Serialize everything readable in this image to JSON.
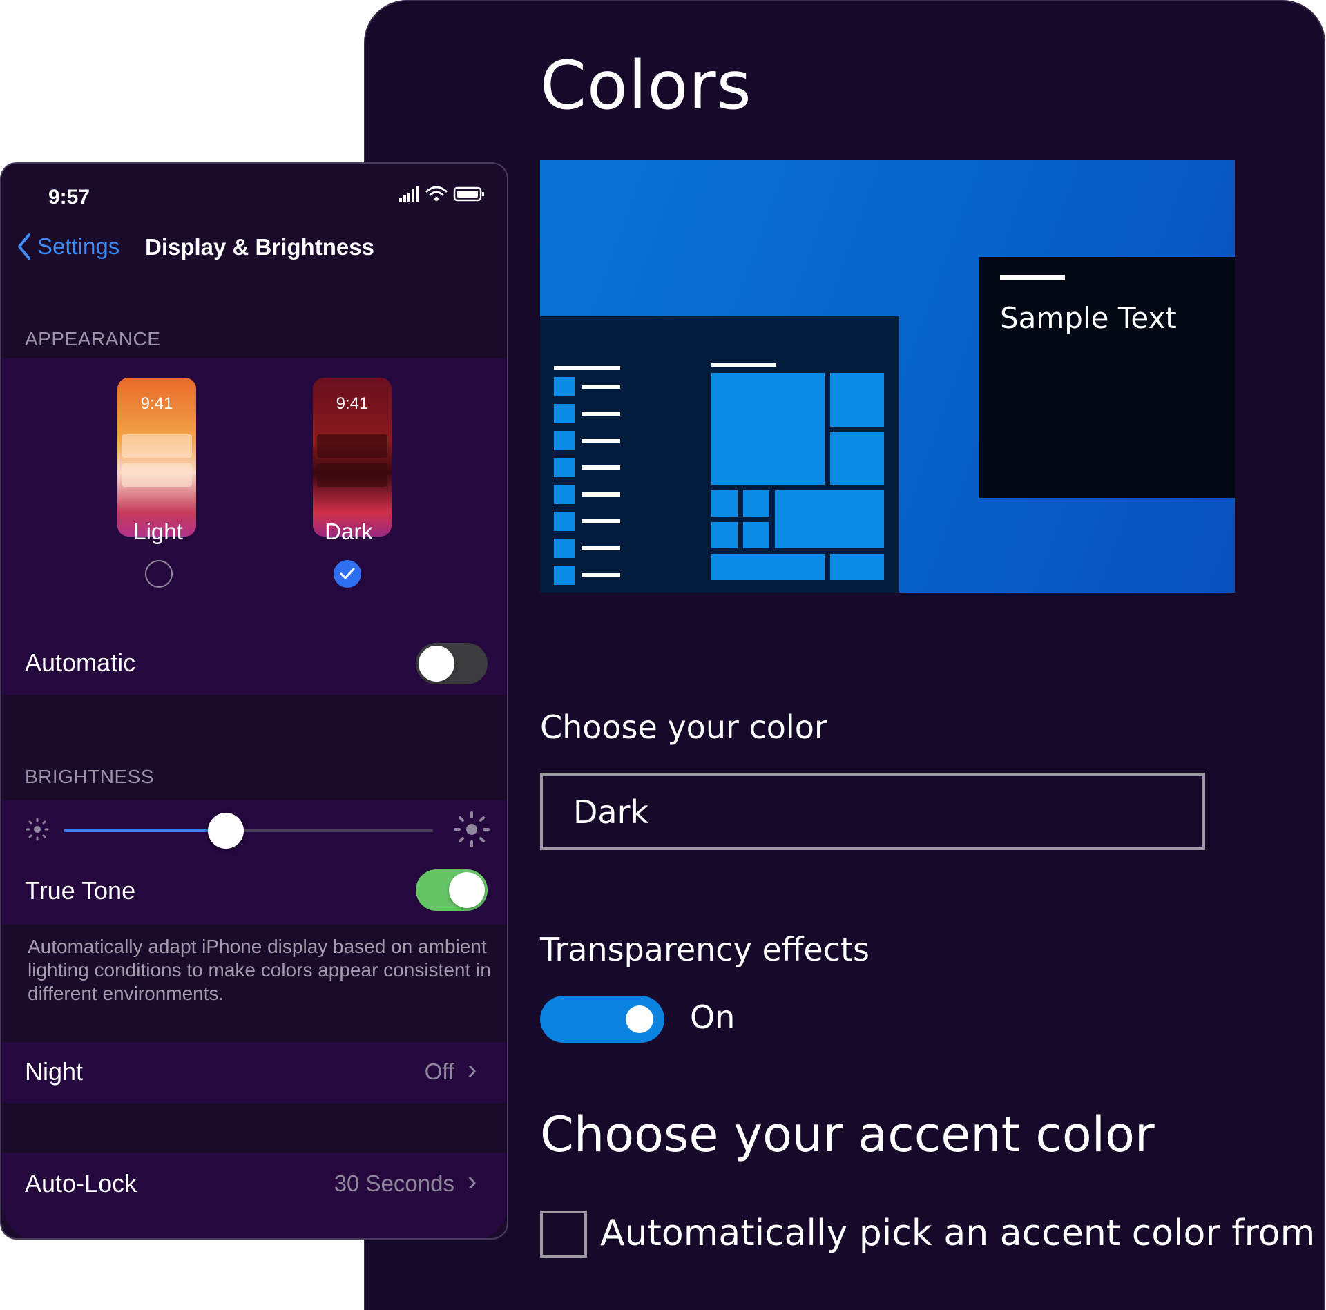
{
  "windows": {
    "title": "Colors",
    "preview_sample_text": "Sample Text",
    "choose_color_label": "Choose your color",
    "choose_color_value": "Dark",
    "transparency_label": "Transparency effects",
    "transparency_state": "On",
    "accent_title": "Choose your accent color",
    "auto_accent_label": "Automatically pick an accent color from my",
    "colors": {
      "accent": "#0a82e0",
      "background": "#17092a"
    }
  },
  "phone": {
    "status_time": "9:57",
    "nav": {
      "back_label": "Settings",
      "title": "Display & Brightness"
    },
    "appearance": {
      "header": "APPEARANCE",
      "options": [
        {
          "label": "Light",
          "thumb_time": "9:41",
          "selected": false
        },
        {
          "label": "Dark",
          "thumb_time": "9:41",
          "selected": true
        }
      ],
      "automatic_label": "Automatic",
      "automatic_on": false
    },
    "brightness": {
      "header": "BRIGHTNESS",
      "level": 0.44,
      "true_tone_label": "True Tone",
      "true_tone_on": true,
      "true_tone_desc": "Automatically adapt iPhone display based on ambient lighting conditions to make colors appear consistent in different environments."
    },
    "night": {
      "label": "Night",
      "value": "Off"
    },
    "auto_lock": {
      "label": "Auto-Lock",
      "value": "30 Seconds"
    },
    "colors": {
      "link": "#3e8cf7",
      "toggle_on": "#65c466",
      "group_bg": "#25083e"
    }
  }
}
